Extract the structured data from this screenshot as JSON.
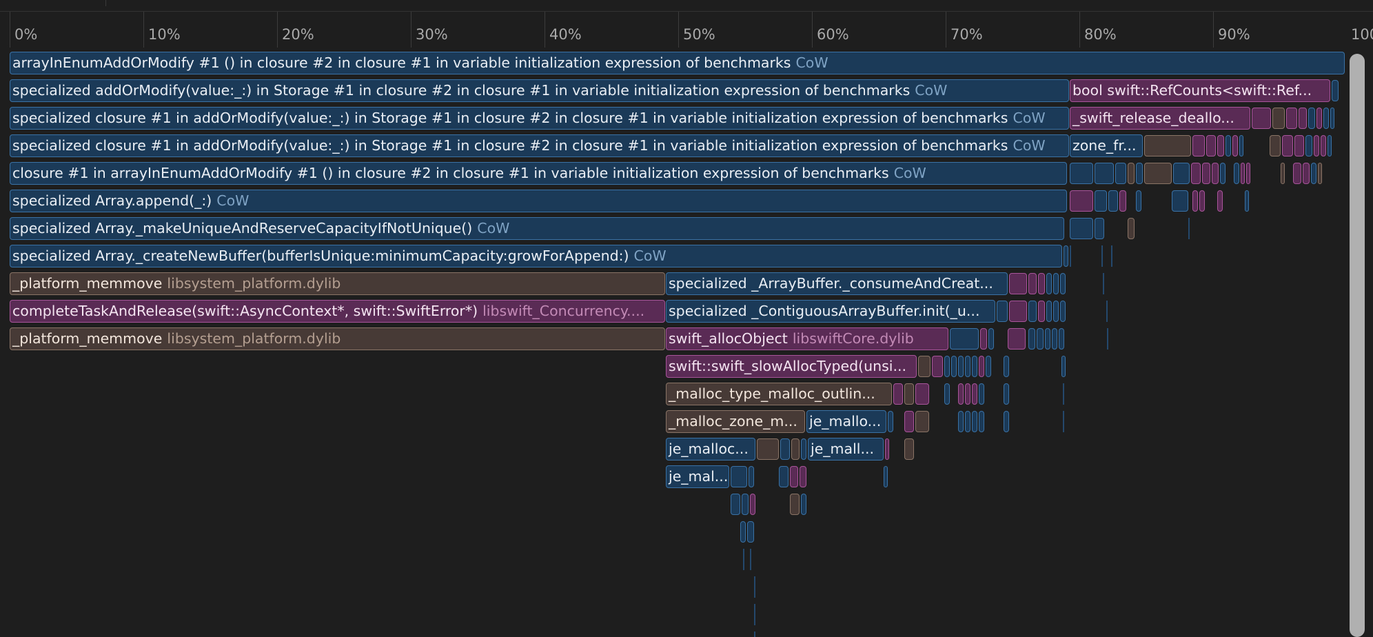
{
  "ruler": {
    "ticks": [
      "0%",
      "10%",
      "20%",
      "30%",
      "40%",
      "50%",
      "60%",
      "70%",
      "80%",
      "90%",
      "100%"
    ]
  },
  "frames": [
    {
      "name": "arrayInEnumAddOrModify #1 () in closure #2 in closure #1 in variable initialization expression of benchmarks",
      "lib": "CoW",
      "kind": "swift"
    },
    {
      "name": "specialized addOrModify(value:_:) in Storage #1 in closure #2 in closure #1 in variable initialization expression of benchmarks",
      "lib": "CoW",
      "kind": "swift"
    },
    {
      "name": "bool swift::RefCounts<swift::Ref...",
      "lib": "",
      "kind": "runtime"
    },
    {
      "name": "specialized closure #1 in addOrModify(value:_:) in Storage #1 in closure #2 in closure #1 in variable initialization expression of benchmarks",
      "lib": "CoW",
      "kind": "swift"
    },
    {
      "name": "_swift_release_deallo...",
      "lib": "",
      "kind": "runtime"
    },
    {
      "name": "specialized closure #1 in addOrModify(value:_:) in Storage #1 in closure #2 in closure #1 in variable initialization expression of benchmarks",
      "lib": "CoW",
      "kind": "swift"
    },
    {
      "name": "zone_fr...",
      "lib": "",
      "kind": "swift"
    },
    {
      "name": "closure #1 in arrayInEnumAddOrModify #1 () in closure #2 in closure #1 in variable initialization expression of benchmarks",
      "lib": "CoW",
      "kind": "swift"
    },
    {
      "name": "specialized Array.append(_:)",
      "lib": "CoW",
      "kind": "swift"
    },
    {
      "name": "specialized Array._makeUniqueAndReserveCapacityIfNotUnique()",
      "lib": "CoW",
      "kind": "swift"
    },
    {
      "name": "specialized Array._createNewBuffer(bufferIsUnique:minimumCapacity:growForAppend:)",
      "lib": "CoW",
      "kind": "swift"
    },
    {
      "name": "_platform_memmove",
      "lib": "libsystem_platform.dylib",
      "kind": "system"
    },
    {
      "name": "specialized _ArrayBuffer._consumeAndCreat...",
      "lib": "",
      "kind": "swift"
    },
    {
      "name": "completeTaskAndRelease(swift::AsyncContext*, swift::SwiftError*)",
      "lib": "libswift_Concurrency....",
      "kind": "runtime"
    },
    {
      "name": "specialized _ContiguousArrayBuffer.init(_u...",
      "lib": "",
      "kind": "swift"
    },
    {
      "name": "_platform_memmove",
      "lib": "libsystem_platform.dylib",
      "kind": "system"
    },
    {
      "name": "swift_allocObject",
      "lib": "libswiftCore.dylib",
      "kind": "runtime"
    },
    {
      "name": "swift::swift_slowAllocTyped(unsi...",
      "lib": "",
      "kind": "runtime"
    },
    {
      "name": "_malloc_type_malloc_outlin...",
      "lib": "",
      "kind": "system"
    },
    {
      "name": "_malloc_zone_m...",
      "lib": "",
      "kind": "system"
    },
    {
      "name": "je_mallo...",
      "lib": "",
      "kind": "swift"
    },
    {
      "name": "je_malloc...",
      "lib": "",
      "kind": "swift"
    },
    {
      "name": "je_mall...",
      "lib": "",
      "kind": "swift"
    },
    {
      "name": "je_mal...",
      "lib": "",
      "kind": "swift"
    }
  ],
  "colors": {
    "swift": "#1b3a58",
    "system": "#473a36",
    "runtime": "#5a2b55",
    "background": "#1e1e1e"
  }
}
